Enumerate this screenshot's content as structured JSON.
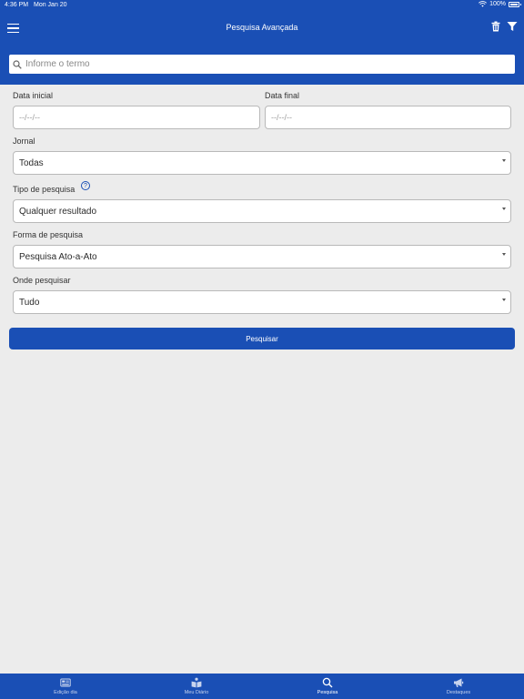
{
  "status_bar": {
    "time": "4:36 PM",
    "date": "Mon Jan 20",
    "battery": "100%"
  },
  "header": {
    "title": "Pesquisa Avançada"
  },
  "search": {
    "placeholder": "Informe o termo"
  },
  "form": {
    "start_date": {
      "label": "Data inicial",
      "placeholder": "--/--/--"
    },
    "end_date": {
      "label": "Data final",
      "placeholder": "--/--/--"
    },
    "journal": {
      "label": "Jornal",
      "value": "Todas"
    },
    "search_type": {
      "label": "Tipo de pesquisa",
      "value": "Qualquer resultado",
      "help": "?"
    },
    "search_form": {
      "label": "Forma de pesquisa",
      "value": "Pesquisa Ato-a-Ato"
    },
    "where": {
      "label": "Onde pesquisar",
      "value": "Tudo"
    },
    "submit_label": "Pesquisar"
  },
  "tabs": [
    {
      "label": "Edição dia",
      "icon": "newspaper-icon"
    },
    {
      "label": "Meu Diário",
      "icon": "open-book-icon"
    },
    {
      "label": "Pesquisa",
      "icon": "search-icon",
      "active": true
    },
    {
      "label": "Destaques",
      "icon": "megaphone-icon"
    }
  ],
  "colors": {
    "primary": "#1a4fb5",
    "background": "#ececec",
    "field_border": "#b9b9b9"
  }
}
